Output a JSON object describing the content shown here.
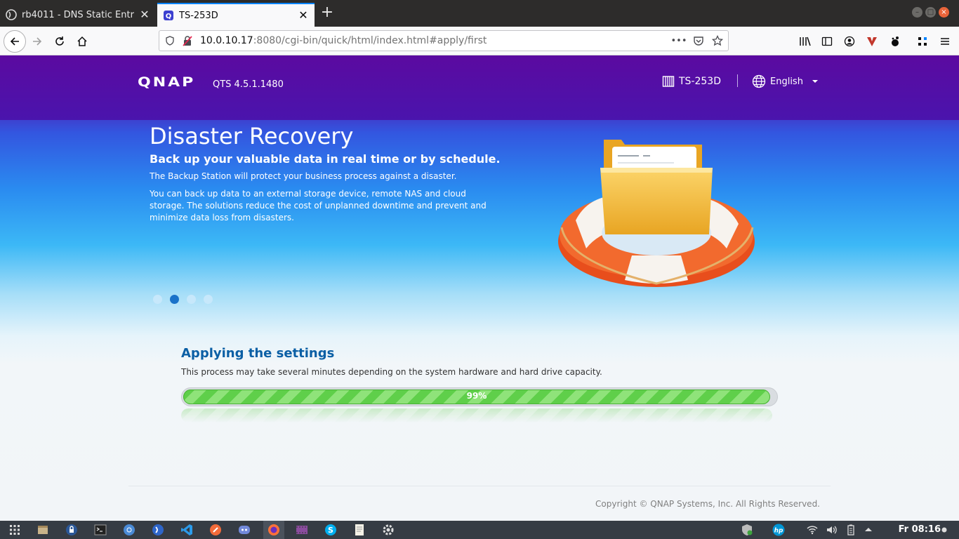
{
  "browser": {
    "tabs": [
      {
        "label": "rb4011 - DNS Static Entr",
        "active": false
      },
      {
        "label": "TS-253D",
        "active": true
      }
    ],
    "url": {
      "host": "10.0.10.17",
      "rest": ":8080/cgi-bin/quick/html/index.html#apply/first"
    },
    "url_more": "•••"
  },
  "header": {
    "logo": "QNAP",
    "version": "QTS 4.5.1.1480",
    "model": "TS-253D",
    "language": "English"
  },
  "banner": {
    "title": "Disaster Recovery",
    "subtitle": "Back up your valuable data in real time or by schedule.",
    "paragraph1": "The Backup Station will protect your business process against a disaster.",
    "paragraph2": "You can back up data to an external storage device, remote NAS and cloud storage. The solutions reduce the cost of unplanned downtime and prevent and minimize data loss from disasters.",
    "slide_count": 4,
    "active_slide": 2
  },
  "apply": {
    "title": "Applying the settings",
    "description": "This process may take several minutes depending on the system hardware and hard drive capacity.",
    "progress_percent": 99,
    "progress_label": "99%"
  },
  "footer": {
    "copyright": "Copyright © QNAP Systems, Inc. All Rights Reserved."
  },
  "taskbar": {
    "clock": "Fr 08:16"
  },
  "colors": {
    "header_purple": "#5b0aa0",
    "title_blue": "#0b5fa5",
    "progress_green": "#5fcf4a"
  }
}
